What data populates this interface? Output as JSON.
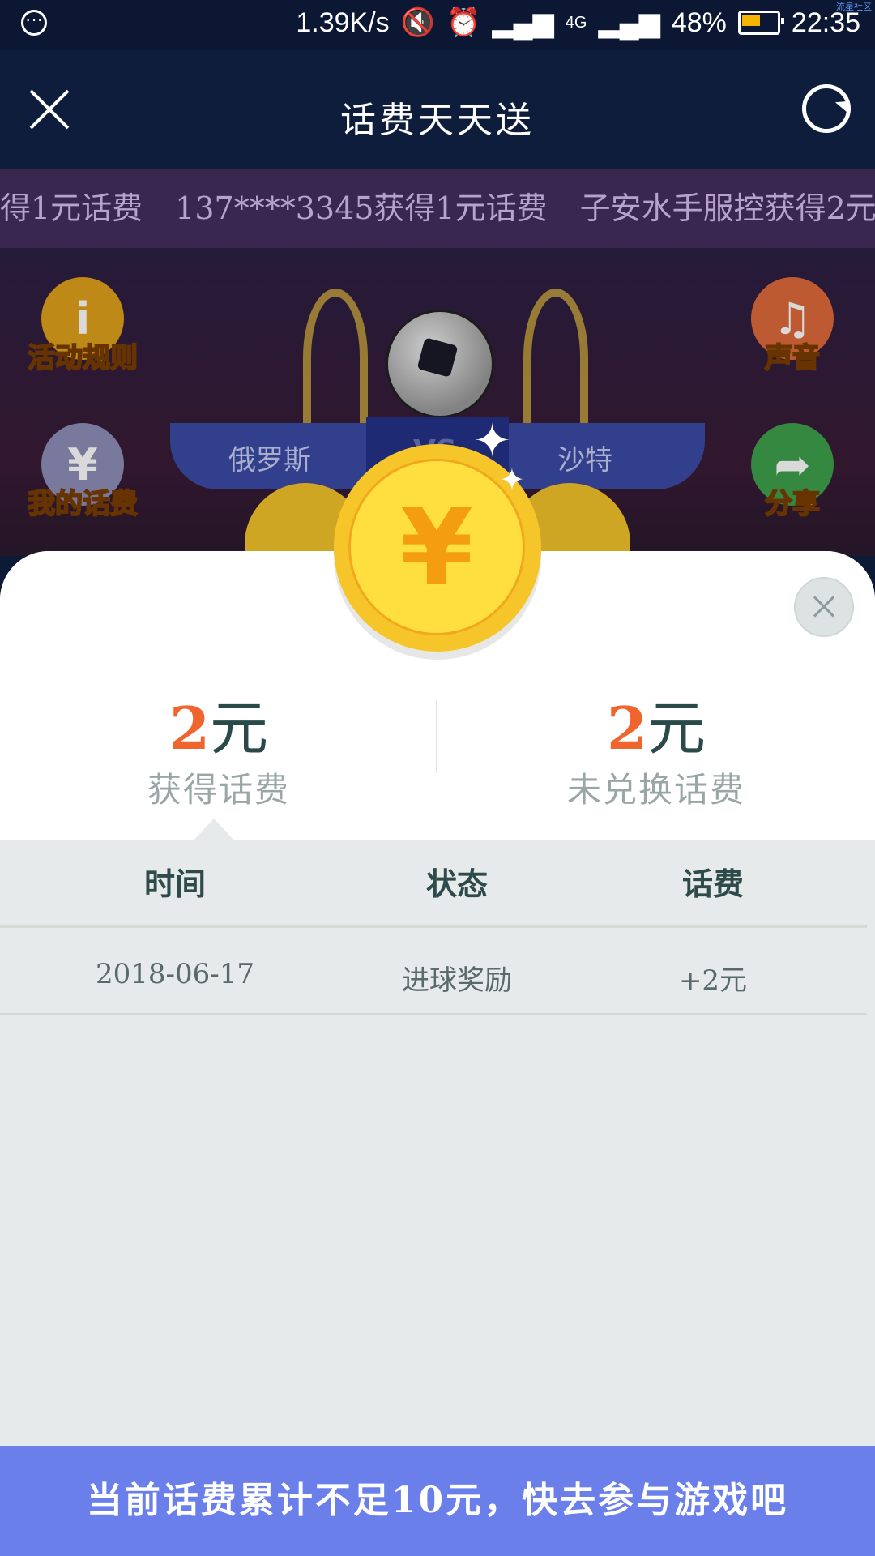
{
  "status_bar": {
    "net_speed": "1.39K/s",
    "battery": "48%",
    "time": "22:35",
    "network": "4G",
    "watermark": "流星社区",
    "battery_color": "#f5b400"
  },
  "nav": {
    "title": "话费天天送"
  },
  "ticker": {
    "items": [
      "得1元话费",
      "137****3345获得1元话费",
      "子安水手服控获得2元话"
    ]
  },
  "game": {
    "left_buttons": [
      {
        "label": "活动规则",
        "icon": "info-icon",
        "color": "#e0a11a"
      },
      {
        "label": "我的话费",
        "icon": "phone-yuan-icon",
        "color": "#8d8fb8"
      }
    ],
    "right_buttons": [
      {
        "label": "声音",
        "icon": "music-note-icon",
        "color": "#e06a3a"
      },
      {
        "label": "分享",
        "icon": "share-arrow-icon",
        "color": "#3ea04a"
      }
    ],
    "team_left": "俄罗斯",
    "team_right": "沙特",
    "vs": "VS"
  },
  "sheet": {
    "earned": {
      "amount": "2",
      "unit": "元",
      "label": "获得话费"
    },
    "unredeemed": {
      "amount": "2",
      "unit": "元",
      "label": "未兑换话费"
    },
    "coin_symbol": "¥",
    "table": {
      "headers": [
        "时间",
        "状态",
        "话费"
      ],
      "rows": [
        [
          "2018-06-17",
          "进球奖励",
          "+2元"
        ]
      ]
    }
  },
  "banner": {
    "text": "当前话费累计不足10元，快去参与游戏吧"
  },
  "colors": {
    "accent": "#f0642e",
    "banner": "#6b7fea",
    "coin": "#f5c52a"
  }
}
